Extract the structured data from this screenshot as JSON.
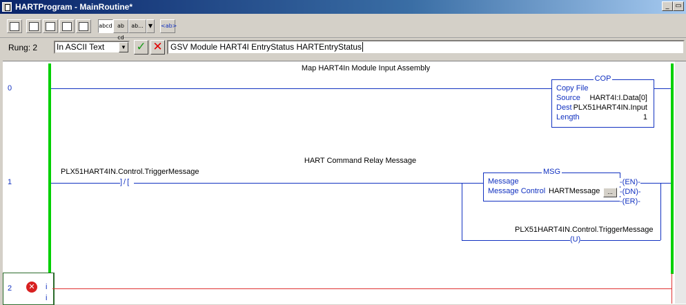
{
  "window": {
    "title": "HARTProgram - MainRoutine*"
  },
  "toolbar": {
    "buttons": [
      "rung-icon",
      "branch-icon",
      "branch-level-icon",
      "start-rung-icon",
      "end-rung-icon"
    ],
    "view_buttons": [
      "abcd",
      "ab cd",
      "ab..."
    ],
    "ascii_button": "<ab>"
  },
  "rung_bar": {
    "rung_label": "Rung: 2",
    "mode_value": "In ASCII Text",
    "rung_text": "GSV Module HART4I EntryStatus HARTEntryStatus"
  },
  "rungs": [
    {
      "number": "0",
      "comment": "Map HART4In Module Input Assembly",
      "instruction": {
        "name": "COP",
        "title": "Copy File",
        "rows": [
          {
            "label": "Source",
            "value": "HART4I:I.Data[0]"
          },
          {
            "label": "Dest",
            "value": "PLX51HART4IN.Input"
          },
          {
            "label": "Length",
            "value": "1"
          }
        ]
      }
    },
    {
      "number": "1",
      "comment": "HART Command Relay Message",
      "contact_tag": "PLX51HART4IN.Control.TriggerMessage",
      "contact_symbol": "]/[",
      "instruction": {
        "name": "MSG",
        "title": "Message",
        "control_label": "Message Control",
        "control_value": "HARTMessage",
        "browse_label": "...",
        "outputs": [
          "EN",
          "DN",
          "ER"
        ]
      },
      "branch_tag": "PLX51HART4IN.Control.TriggerMessage",
      "branch_coil": "U"
    },
    {
      "number": "2",
      "markers": [
        "i",
        "i"
      ]
    }
  ]
}
